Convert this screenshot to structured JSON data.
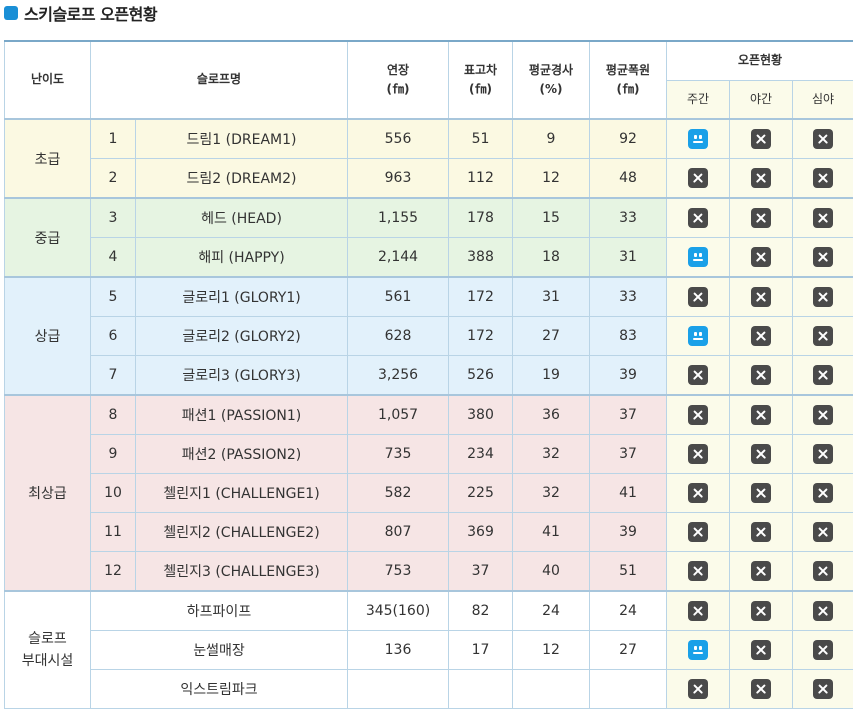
{
  "title": "스키슬로프 오픈현황",
  "headers": {
    "level": "난이도",
    "slope": "슬로프명",
    "length": "연장",
    "length_unit": "(㎙)",
    "elev": "표고차",
    "elev_unit": "(㎙)",
    "grade": "평균경사",
    "grade_unit": "(%)",
    "width": "평균폭원",
    "width_unit": "(㎙)",
    "status": "오픈현황",
    "day": "주간",
    "night": "야간",
    "late": "심야"
  },
  "groups": {
    "beginner": "초급",
    "intermediate": "중급",
    "advanced": "상급",
    "expert": "최상급",
    "facility_line1": "슬로프",
    "facility_line2": "부대시설"
  },
  "rows": [
    {
      "no": "1",
      "name": "드림1 (DREAM1)",
      "length": "556",
      "elev": "51",
      "grade": "9",
      "width": "92",
      "day": "open",
      "night": "closed",
      "late": "closed"
    },
    {
      "no": "2",
      "name": "드림2 (DREAM2)",
      "length": "963",
      "elev": "112",
      "grade": "12",
      "width": "48",
      "day": "closed",
      "night": "closed",
      "late": "closed"
    },
    {
      "no": "3",
      "name": "헤드 (HEAD)",
      "length": "1,155",
      "elev": "178",
      "grade": "15",
      "width": "33",
      "day": "closed",
      "night": "closed",
      "late": "closed"
    },
    {
      "no": "4",
      "name": "해피 (HAPPY)",
      "length": "2,144",
      "elev": "388",
      "grade": "18",
      "width": "31",
      "day": "open",
      "night": "closed",
      "late": "closed"
    },
    {
      "no": "5",
      "name": "글로리1 (GLORY1)",
      "length": "561",
      "elev": "172",
      "grade": "31",
      "width": "33",
      "day": "closed",
      "night": "closed",
      "late": "closed"
    },
    {
      "no": "6",
      "name": "글로리2 (GLORY2)",
      "length": "628",
      "elev": "172",
      "grade": "27",
      "width": "83",
      "day": "open",
      "night": "closed",
      "late": "closed"
    },
    {
      "no": "7",
      "name": "글로리3 (GLORY3)",
      "length": "3,256",
      "elev": "526",
      "grade": "19",
      "width": "39",
      "day": "closed",
      "night": "closed",
      "late": "closed"
    },
    {
      "no": "8",
      "name": "패션1 (PASSION1)",
      "length": "1,057",
      "elev": "380",
      "grade": "36",
      "width": "37",
      "day": "closed",
      "night": "closed",
      "late": "closed"
    },
    {
      "no": "9",
      "name": "패션2 (PASSION2)",
      "length": "735",
      "elev": "234",
      "grade": "32",
      "width": "37",
      "day": "closed",
      "night": "closed",
      "late": "closed"
    },
    {
      "no": "10",
      "name": "첼린지1 (CHALLENGE1)",
      "length": "582",
      "elev": "225",
      "grade": "32",
      "width": "41",
      "day": "closed",
      "night": "closed",
      "late": "closed"
    },
    {
      "no": "11",
      "name": "첼린지2 (CHALLENGE2)",
      "length": "807",
      "elev": "369",
      "grade": "41",
      "width": "39",
      "day": "closed",
      "night": "closed",
      "late": "closed"
    },
    {
      "no": "12",
      "name": "첼린지3 (CHALLENGE3)",
      "length": "753",
      "elev": "37",
      "grade": "40",
      "width": "51",
      "day": "closed",
      "night": "closed",
      "late": "closed"
    }
  ],
  "facilities": [
    {
      "name": "하프파이프",
      "length": "345(160)",
      "elev": "82",
      "grade": "24",
      "width": "24",
      "day": "closed",
      "night": "closed",
      "late": "closed"
    },
    {
      "name": "눈썰매장",
      "length": "136",
      "elev": "17",
      "grade": "12",
      "width": "27",
      "day": "open",
      "night": "closed",
      "late": "closed"
    },
    {
      "name": "익스트림파크",
      "length": "",
      "elev": "",
      "grade": "",
      "width": "",
      "day": "closed",
      "night": "closed",
      "late": "closed"
    }
  ],
  "icons": {
    "open": "open-smiley-icon",
    "closed": "closed-x-icon",
    "open_color": "#1aa0e8",
    "closed_color": "#4a4a4a",
    "title_color": "#1a8fd6"
  }
}
